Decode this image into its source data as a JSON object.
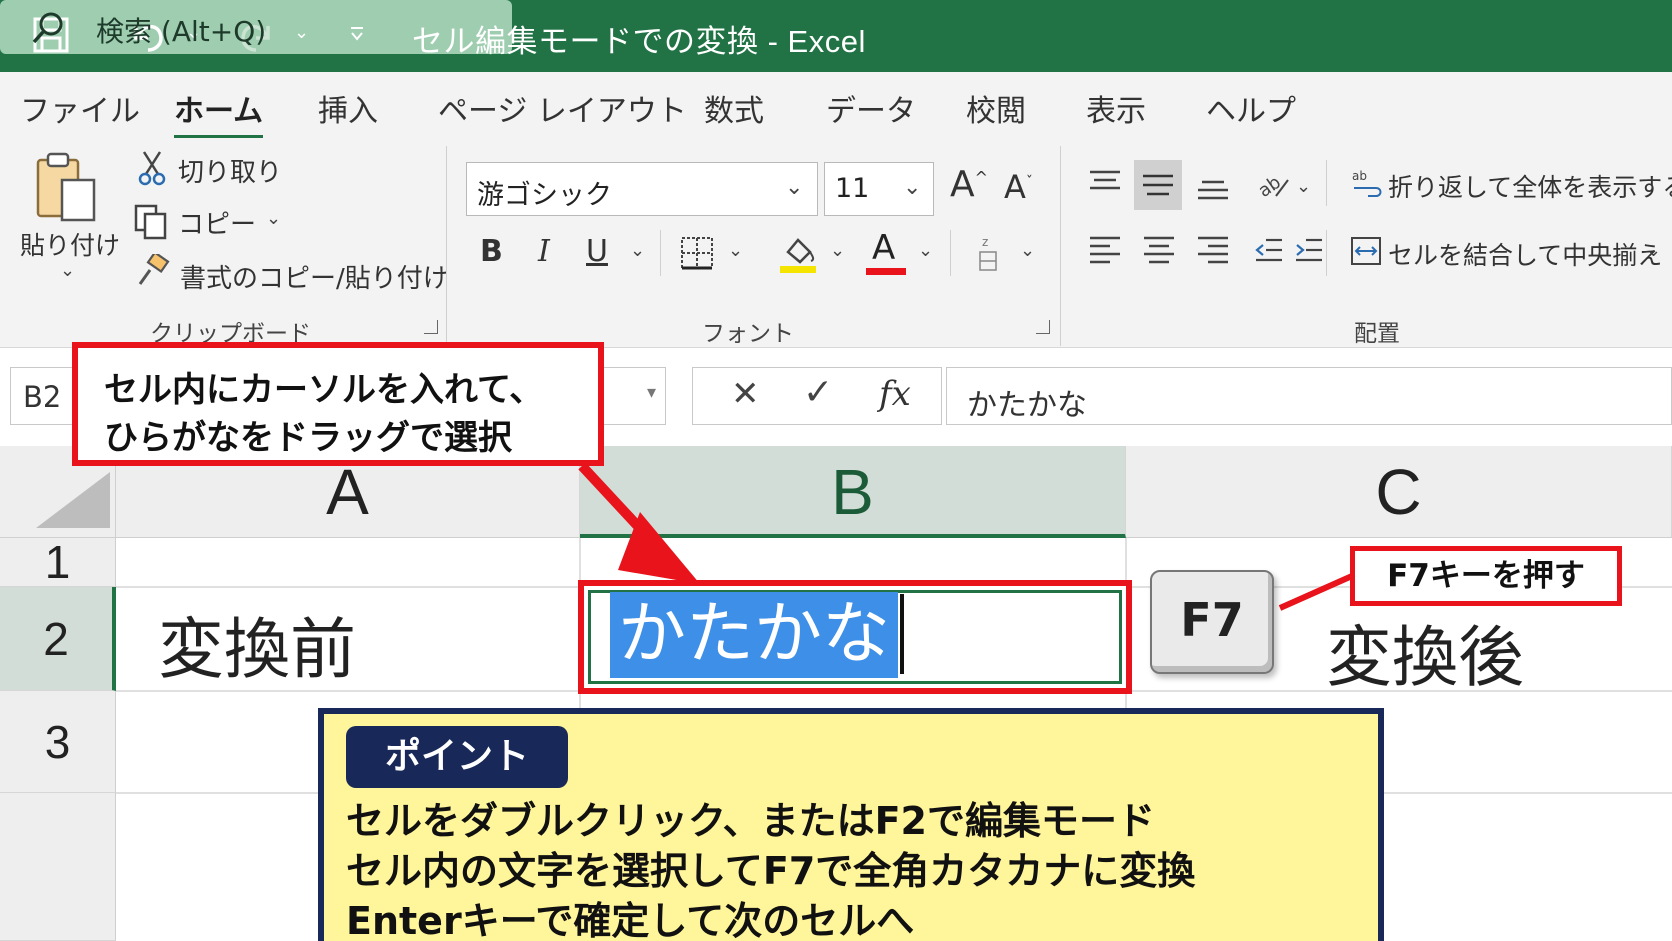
{
  "titlebar": {
    "title": "セル編集モードでの変換  -  Excel",
    "search_text": "検索 (Alt+Q)"
  },
  "tabs": [
    {
      "label": "ファイル",
      "active": false
    },
    {
      "label": "ホーム",
      "active": true
    },
    {
      "label": "挿入",
      "active": false
    },
    {
      "label": "ページ レイアウト",
      "active": false
    },
    {
      "label": "数式",
      "active": false
    },
    {
      "label": "データ",
      "active": false
    },
    {
      "label": "校閲",
      "active": false
    },
    {
      "label": "表示",
      "active": false
    },
    {
      "label": "ヘルプ",
      "active": false
    }
  ],
  "clipboard": {
    "paste": "貼り付け",
    "cut": "切り取り",
    "copy": "コピー",
    "format_painter": "書式のコピー/貼り付け",
    "group_label": "クリップボード"
  },
  "font": {
    "font_name": "游ゴシック",
    "font_size": "11",
    "group_label": "フォント",
    "bold": "B",
    "italic": "I",
    "underline": "U",
    "font_color_letter": "A",
    "highlight_color": "#f5e400",
    "font_color": "#e8131b"
  },
  "alignment": {
    "wrap_text": "折り返して全体を表示する",
    "merge_center": "セルを結合して中央揃え",
    "group_label": "配置"
  },
  "formula_bar": {
    "name_box": "B2",
    "formula": "かたかな"
  },
  "sheet": {
    "columns": [
      "A",
      "B",
      "C"
    ],
    "rows": [
      "1",
      "2",
      "3"
    ],
    "a2": "変換前",
    "b2_selected": "かたかな",
    "c2": "変換後"
  },
  "annotations": {
    "callout_line1": "セル内にカーソルを入れて、",
    "callout_line2": "ひらがなをドラッグで選択",
    "f7_key": "F7",
    "f7_label": "F7キーを押す",
    "point_title": "ポイント",
    "point_lines": [
      "セルをダブルクリック、またはF2で編集モード",
      "セル内の文字を選択してF7で全角カタカナに変換",
      "Enterキーで確定して次のセルへ"
    ]
  },
  "colors": {
    "excel_green": "#217346",
    "annotation_red": "#e8131b",
    "selection_blue": "#3d8fe8",
    "point_bg": "#fff59a",
    "point_border": "#182858"
  }
}
